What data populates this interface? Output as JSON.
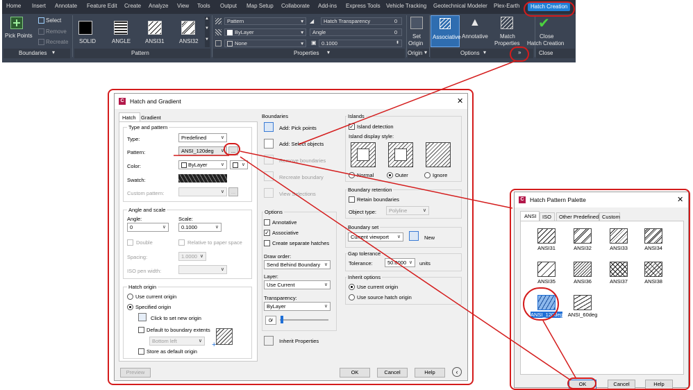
{
  "ribbon": {
    "tabs": [
      "Home",
      "Insert",
      "Annotate",
      "Feature Edit",
      "Create",
      "Analyze",
      "View",
      "Tools",
      "Output",
      "Map Setup",
      "Collaborate",
      "Add-ins",
      "Express Tools",
      "Vehicle Tracking",
      "Geotechnical Modeler",
      "Plex-Earth",
      "Hatch Creation"
    ],
    "boundaries": {
      "pick_points": "Pick Points",
      "select": "Select",
      "remove": "Remove",
      "recreate": "Recreate",
      "panel": "Boundaries"
    },
    "pattern": {
      "items": [
        "SOLID",
        "ANGLE",
        "ANSI31",
        "ANSI32"
      ],
      "panel": "Pattern"
    },
    "properties": {
      "type": "Pattern",
      "color": "ByLayer",
      "bg": "None",
      "transparency_label": "Hatch Transparency",
      "transparency_value": "0",
      "angle_label": "Angle",
      "angle_value": "0",
      "scale_value": "0.1000",
      "panel": "Properties"
    },
    "origin": {
      "set": "Set",
      "origin": "Origin",
      "panel": "Origin"
    },
    "options": {
      "associative": "Associative",
      "annotative": "Annotative",
      "match": "Match",
      "properties": "Properties",
      "panel": "Options",
      "launcher": "»"
    },
    "close": {
      "close": "Close",
      "hatch_creation": "Hatch Creation",
      "panel": "Close"
    }
  },
  "hatch_dialog": {
    "title": "Hatch and Gradient",
    "tabs": [
      "Hatch",
      "Gradient"
    ],
    "type_pattern": {
      "heading": "Type and pattern",
      "type_label": "Type:",
      "type_value": "Predefined",
      "pattern_label": "Pattern:",
      "pattern_value": "ANSI_120deg",
      "browse": "...",
      "color_label": "Color:",
      "color_value": "ByLayer",
      "swatch_label": "Swatch:",
      "custom_label": "Custom pattern:"
    },
    "angle_scale": {
      "heading": "Angle and scale",
      "angle_label": "Angle:",
      "angle_value": "0",
      "scale_label": "Scale:",
      "scale_value": "0.1000",
      "double": "Double",
      "relative": "Relative to paper space",
      "spacing_label": "Spacing:",
      "spacing_value": "1.0000",
      "iso_label": "ISO pen width:"
    },
    "origin": {
      "heading": "Hatch origin",
      "use_current": "Use current origin",
      "specified": "Specified origin",
      "click_set": "Click to set new origin",
      "default_boundary": "Default to boundary extents",
      "position": "Bottom left",
      "store": "Store as default origin"
    },
    "boundaries": {
      "heading": "Boundaries",
      "add_pick": "Add: Pick points",
      "add_select": "Add: Select objects",
      "remove": "Remove boundaries",
      "recreate": "Recreate boundary",
      "view": "View Selections"
    },
    "options": {
      "heading": "Options",
      "annotative": "Annotative",
      "associative": "Associative",
      "separate": "Create separate hatches",
      "draw_order_label": "Draw order:",
      "draw_order_value": "Send Behind Boundary",
      "layer_label": "Layer:",
      "layer_value": "Use Current",
      "transparency_label": "Transparency:",
      "transparency_value": "ByLayer",
      "transparency_num": "0"
    },
    "inherit": "Inherit Properties",
    "islands": {
      "heading": "Islands",
      "detection": "Island detection",
      "style_label": "Island display style:",
      "normal": "Normal",
      "outer": "Outer",
      "ignore": "Ignore"
    },
    "retention": {
      "heading": "Boundary retention",
      "retain": "Retain boundaries",
      "object_type_label": "Object type:",
      "object_type_value": "Polyline"
    },
    "boundary_set": {
      "heading": "Boundary set",
      "value": "Current viewport",
      "new": "New"
    },
    "gap": {
      "heading": "Gap tolerance",
      "tolerance_label": "Tolerance:",
      "tolerance_value": "50.0000",
      "units": "units"
    },
    "inherit_options": {
      "heading": "Inherit options",
      "use_current": "Use current origin",
      "use_source": "Use source hatch origin"
    },
    "buttons": {
      "preview": "Preview",
      "ok": "OK",
      "cancel": "Cancel",
      "help": "Help"
    }
  },
  "palette": {
    "title": "Hatch Pattern Palette",
    "tabs": [
      "ANSI",
      "ISO",
      "Other Predefined",
      "Custom"
    ],
    "patterns": [
      "ANSI31",
      "ANSI32",
      "ANSI33",
      "ANSI34",
      "ANSI35",
      "ANSI36",
      "ANSI37",
      "ANSI38",
      "ANSI_120deg",
      "ANSI_60deg"
    ],
    "buttons": {
      "ok": "OK",
      "cancel": "Cancel",
      "help": "Help"
    }
  }
}
